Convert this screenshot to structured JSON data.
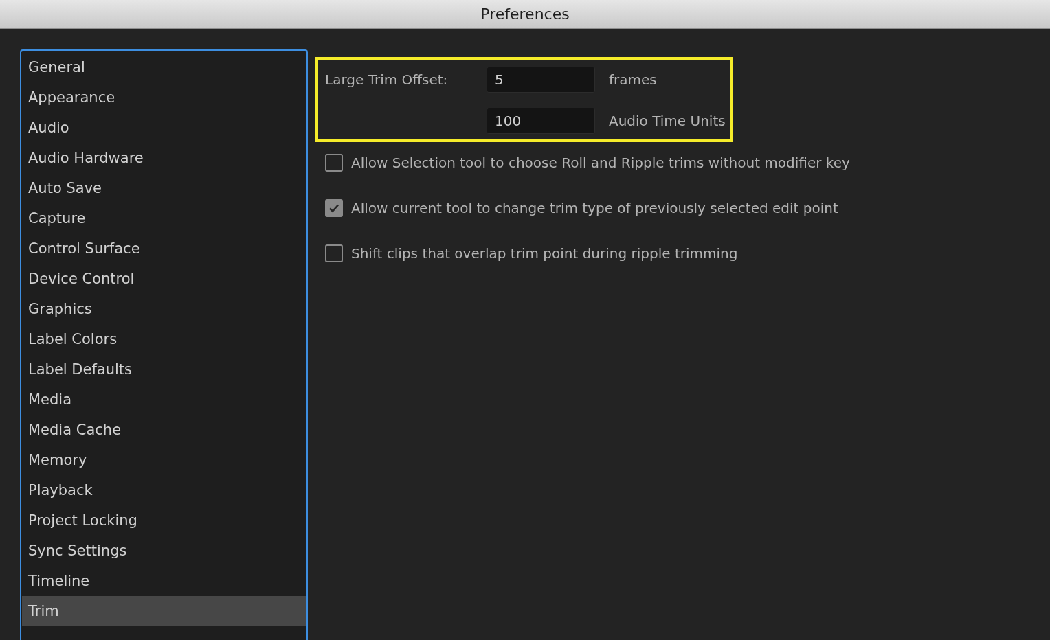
{
  "window": {
    "title": "Preferences"
  },
  "sidebar": {
    "items": [
      {
        "label": "General",
        "selected": false
      },
      {
        "label": "Appearance",
        "selected": false
      },
      {
        "label": "Audio",
        "selected": false
      },
      {
        "label": "Audio Hardware",
        "selected": false
      },
      {
        "label": "Auto Save",
        "selected": false
      },
      {
        "label": "Capture",
        "selected": false
      },
      {
        "label": "Control Surface",
        "selected": false
      },
      {
        "label": "Device Control",
        "selected": false
      },
      {
        "label": "Graphics",
        "selected": false
      },
      {
        "label": "Label Colors",
        "selected": false
      },
      {
        "label": "Label Defaults",
        "selected": false
      },
      {
        "label": "Media",
        "selected": false
      },
      {
        "label": "Media Cache",
        "selected": false
      },
      {
        "label": "Memory",
        "selected": false
      },
      {
        "label": "Playback",
        "selected": false
      },
      {
        "label": "Project Locking",
        "selected": false
      },
      {
        "label": "Sync Settings",
        "selected": false
      },
      {
        "label": "Timeline",
        "selected": false
      },
      {
        "label": "Trim",
        "selected": true
      }
    ]
  },
  "trim_offset": {
    "highlighted": true,
    "label": "Large Trim Offset:",
    "fields": [
      {
        "value": "5",
        "unit": "frames"
      },
      {
        "value": "100",
        "unit": "Audio Time Units"
      }
    ]
  },
  "options": [
    {
      "label": "Allow Selection tool to choose Roll and Ripple trims without modifier key",
      "checked": false
    },
    {
      "label": "Allow current tool to change trim type of previously selected edit point",
      "checked": true
    },
    {
      "label": "Shift clips that overlap trim point during ripple trimming",
      "checked": false
    }
  ]
}
